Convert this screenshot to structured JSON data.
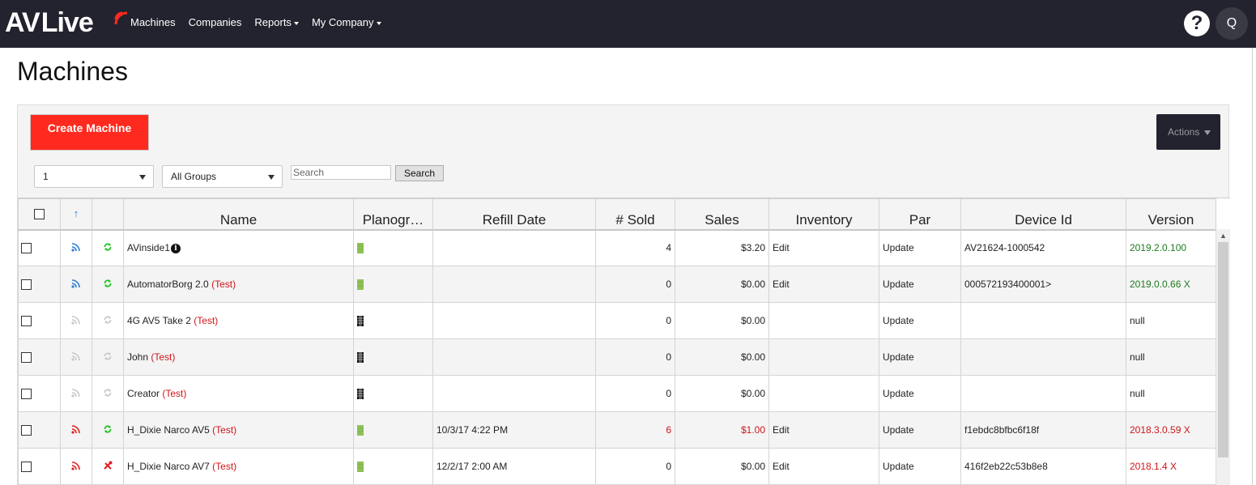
{
  "navbar": {
    "logo_left": "AV",
    "logo_right": "Live",
    "items": [
      {
        "label": "Machines",
        "dropdown": false
      },
      {
        "label": "Companies",
        "dropdown": false
      },
      {
        "label": "Reports",
        "dropdown": true
      },
      {
        "label": "My Company",
        "dropdown": true
      }
    ],
    "help_label": "?",
    "user_initial": "Q"
  },
  "page": {
    "title": "Machines"
  },
  "toolbar": {
    "create_label": "Create Machine",
    "actions_label": "Actions",
    "page_select_value": "1",
    "group_select_value": "All Groups",
    "search_placeholder": "Search",
    "search_button_label": "Search"
  },
  "table": {
    "sort_indicator": "↑",
    "columns": [
      "",
      "",
      "",
      "Name",
      "Planogr…",
      "Refill Date",
      "# Sold",
      "Sales",
      "Inventory",
      "Par",
      "Device Id",
      "Version"
    ],
    "rows": [
      {
        "name": "AVinside1",
        "test": "",
        "info": true,
        "signal": "blue",
        "status": "green",
        "plano": "green",
        "refill": "",
        "sold": "4",
        "sales": "$3.20",
        "inventory": "Edit",
        "par": "Update",
        "device": "AV21624-1000542",
        "version": "2019.2.0.100",
        "version_color": "green",
        "value_color": "normal"
      },
      {
        "name": "AutomatorBorg 2.0",
        "test": "(Test)",
        "info": false,
        "signal": "blue",
        "status": "green",
        "plano": "green",
        "refill": "",
        "sold": "0",
        "sales": "$0.00",
        "inventory": "Edit",
        "par": "Update",
        "device": "000572193400001>",
        "version": "2019.0.0.66 X",
        "version_color": "green",
        "value_color": "normal"
      },
      {
        "name": "4G AV5 Take 2",
        "test": "(Test)",
        "info": false,
        "signal": "gray",
        "status": "gray",
        "plano": "black",
        "refill": "",
        "sold": "0",
        "sales": "$0.00",
        "inventory": "",
        "par": "Update",
        "device": "",
        "version": "null",
        "version_color": "black",
        "value_color": "normal"
      },
      {
        "name": "John",
        "test": "(Test)",
        "info": false,
        "signal": "gray",
        "status": "gray",
        "plano": "black",
        "refill": "",
        "sold": "0",
        "sales": "$0.00",
        "inventory": "",
        "par": "Update",
        "device": "",
        "version": "null",
        "version_color": "black",
        "value_color": "normal"
      },
      {
        "name": "Creator",
        "test": "(Test)",
        "info": false,
        "signal": "gray",
        "status": "gray",
        "plano": "black",
        "refill": "",
        "sold": "0",
        "sales": "$0.00",
        "inventory": "",
        "par": "Update",
        "device": "",
        "version": "null",
        "version_color": "black",
        "value_color": "normal"
      },
      {
        "name": "H_Dixie Narco AV5",
        "test": "(Test)",
        "info": false,
        "signal": "red",
        "status": "green",
        "plano": "green",
        "refill": "10/3/17 4:22 PM",
        "sold": "6",
        "sales": "$1.00",
        "inventory": "Edit",
        "par": "Update",
        "device": "f1ebdc8bfbc6f18f",
        "version": "2018.3.0.59 X",
        "version_color": "red",
        "value_color": "red"
      },
      {
        "name": "H_Dixie Narco AV7",
        "test": "(Test)",
        "info": false,
        "signal": "red",
        "status": "tools",
        "plano": "green",
        "refill": "12/2/17 2:00 AM",
        "sold": "0",
        "sales": "$0.00",
        "inventory": "Edit",
        "par": "Update",
        "device": "416f2eb22c53b8e8",
        "version": "2018.1.4 X",
        "version_color": "red",
        "value_color": "normal"
      }
    ]
  },
  "colors": {
    "navbar_bg": "#23232f",
    "create_button": "#ff2a1f",
    "signal_blue": "#2a7fd4",
    "signal_red": "#e02020",
    "status_green": "#1ec41e",
    "inactive_gray": "#c8c8c8",
    "plano_green": "#8dc257"
  }
}
